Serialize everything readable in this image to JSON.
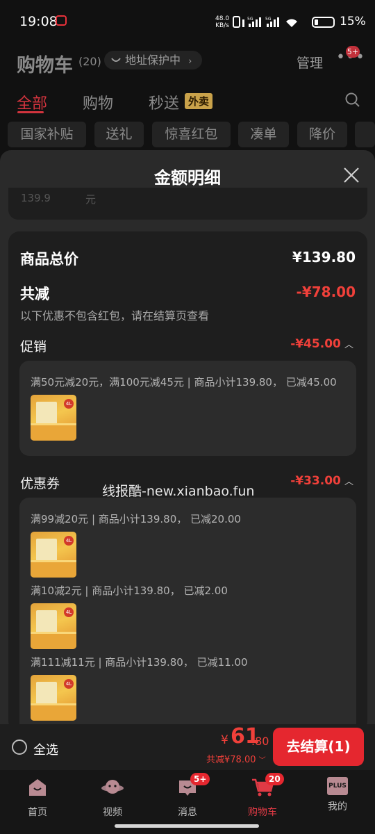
{
  "status_bar": {
    "time": "19:08",
    "net_speed_value": "48.0",
    "net_speed_unit": "KB/s",
    "battery_percent": "15%"
  },
  "header": {
    "title": "购物车",
    "count": "(20)",
    "address_protection": "地址保护中",
    "manage": "管理",
    "message_badge": "5+"
  },
  "tabs": [
    {
      "label": "全部",
      "active": true
    },
    {
      "label": "购物"
    },
    {
      "label": "秒送",
      "tag": "外卖"
    }
  ],
  "filter_chips": [
    "国家补贴",
    "送礼",
    "惊喜红包",
    "凑单",
    "降价"
  ],
  "sheet": {
    "title": "金额明细",
    "peek_left": "139.9",
    "peek_right": "元",
    "goods_total_label": "商品总价",
    "goods_total_value": "¥139.80",
    "total_discount_label": "共减",
    "total_discount_value": "-¥78.00",
    "discount_note": "以下优惠不包含红包，请在结算页查看",
    "promotion": {
      "label": "促销",
      "amount": "-¥45.00",
      "rules": [
        {
          "text": "满50元减20元，满100元减45元 | 商品小计139.80，  已减45.00"
        }
      ]
    },
    "coupon": {
      "label": "优惠券",
      "amount": "-¥33.00",
      "rules": [
        {
          "text": "满99减20元 | 商品小计139.80，  已减20.00"
        },
        {
          "text": "满10减2元 | 商品小计139.80，  已减2.00"
        },
        {
          "text": "满111减11元 | 商品小计139.80，  已减11.00"
        }
      ]
    },
    "product_badge": "4L"
  },
  "watermark": "线报酷-new.xianbao.fun",
  "bottom_bar": {
    "select_all": "全选",
    "yen": "¥",
    "total_int": "61",
    "total_dec": ".80",
    "discount_summary": "共减¥78.00",
    "checkout": "去结算(1)"
  },
  "nav": [
    {
      "label": "首页",
      "icon": "home-icon"
    },
    {
      "label": "视频",
      "icon": "video-icon"
    },
    {
      "label": "消息",
      "icon": "message-icon",
      "badge": "5+"
    },
    {
      "label": "购物车",
      "icon": "cart-icon",
      "badge": "20",
      "active": true
    },
    {
      "label": "我的",
      "icon": "plus-profile-icon",
      "tag": "PLUS"
    }
  ],
  "colors": {
    "accent_red": "#f0403a",
    "checkout_red": "#e5272f",
    "background": "#111111",
    "sheet": "#2a2a2a",
    "card": "#1e1e1e"
  }
}
